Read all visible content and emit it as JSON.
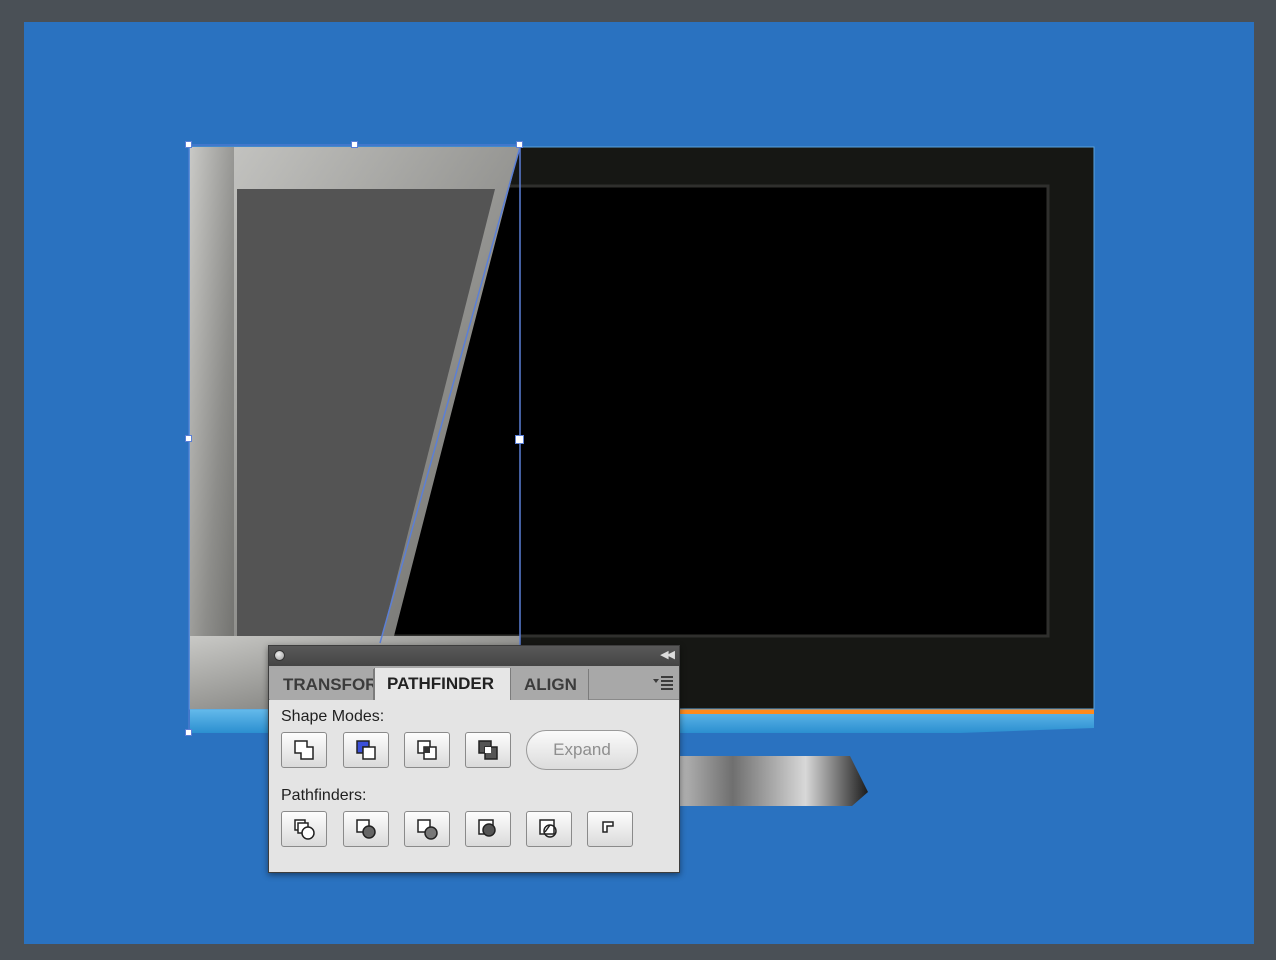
{
  "panel": {
    "tabs": [
      {
        "label": "TRANSFOR",
        "active": false
      },
      {
        "label": "PATHFINDER",
        "active": true
      },
      {
        "label": "ALIGN",
        "active": false
      }
    ],
    "shape_modes_label": "Shape Modes:",
    "pathfinders_label": "Pathfinders:",
    "expand_label": "Expand",
    "shape_mode_buttons": [
      "unite-icon",
      "minus-front-icon",
      "intersect-icon",
      "exclude-icon"
    ],
    "pathfinder_buttons": [
      "divide-icon",
      "trim-icon",
      "merge-icon",
      "crop-icon",
      "outline-icon",
      "minus-back-icon"
    ],
    "collapse_icon": "double-chevron-left-icon",
    "menu_icon": "panel-menu-icon"
  },
  "colors": {
    "artboard": "#2a72c0",
    "frame": "#4a5056",
    "tv_bezel": "#161714",
    "screen": "#000000",
    "accent_strip": "#ff8a1c",
    "selection": "#5b7fd6"
  }
}
